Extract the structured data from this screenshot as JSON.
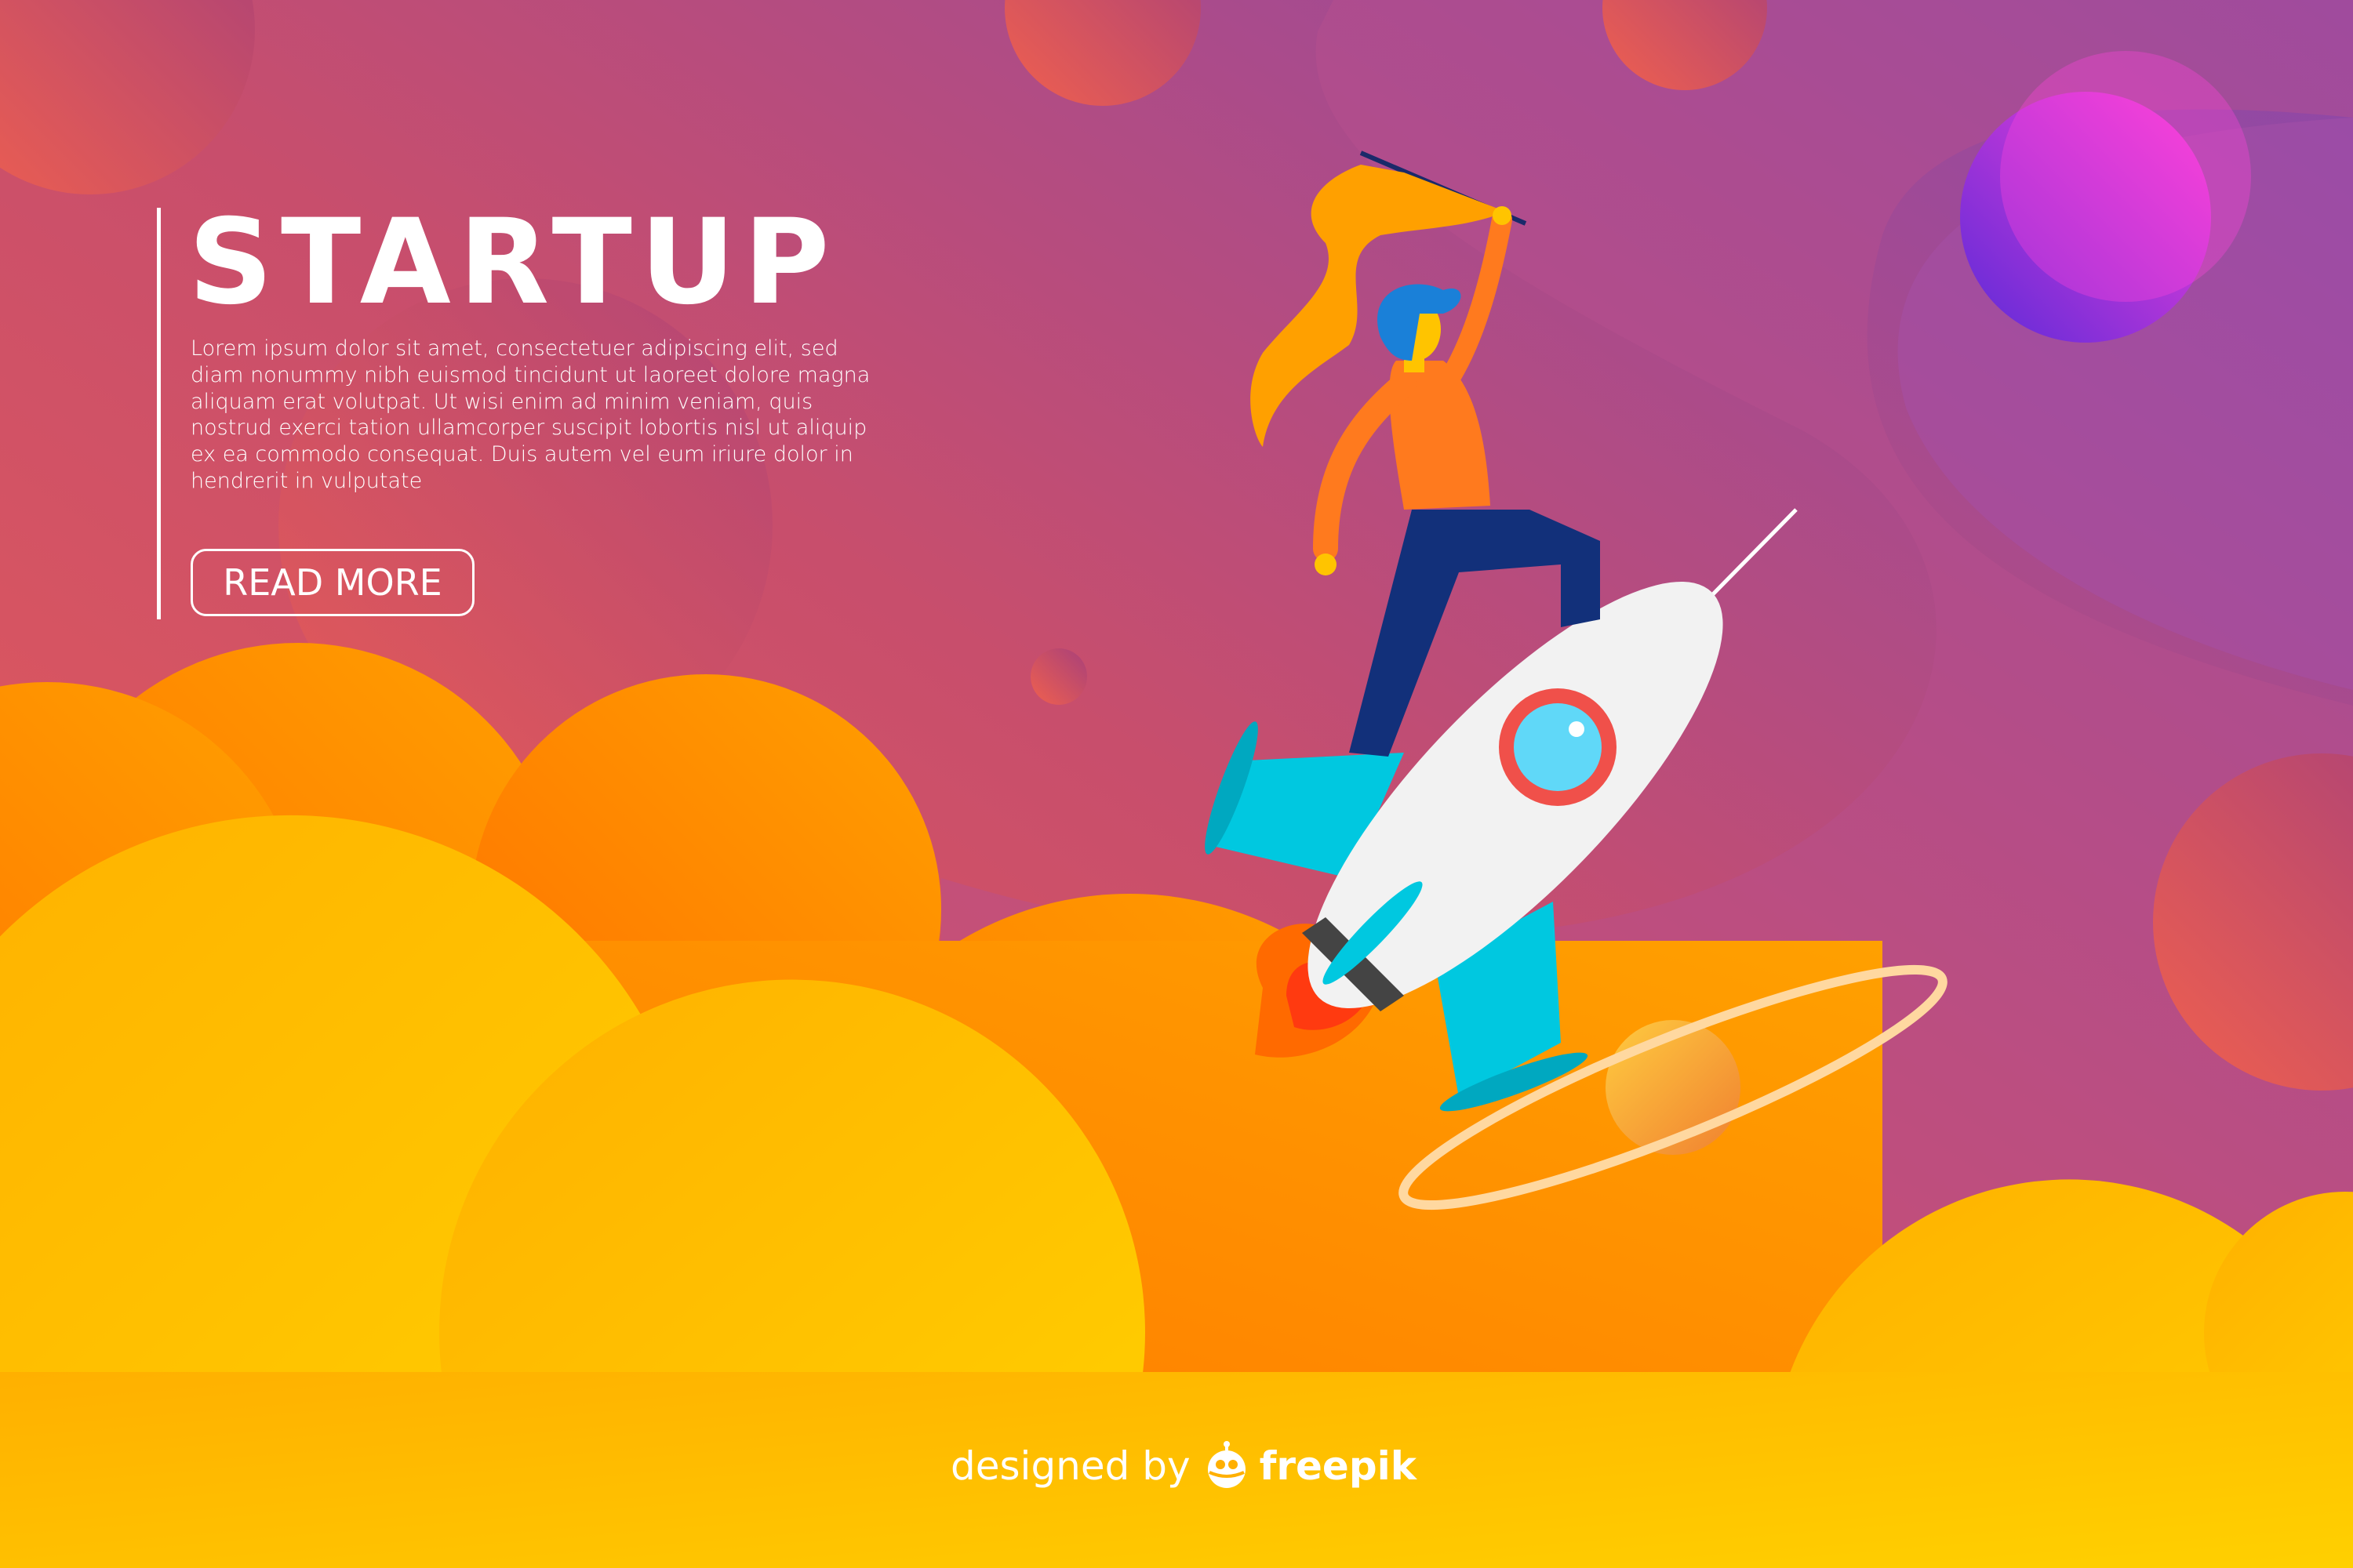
{
  "hero": {
    "title": "STARTUP",
    "body": "Lorem ipsum dolor sit amet, consectetuer adipiscing elit, sed diam nonummy nibh euismod tincidunt ut laoreet dolore magna aliquam erat volutpat. Ut wisi enim ad minim veniam, quis nostrud exerci tation ullamcorper suscipit lobortis nisl ut aliquip ex ea commodo consequat. Duis autem vel eum iriure dolor in hendrerit in vulputate",
    "button_label": "READ MORE"
  },
  "credit": {
    "prefix": "designed by",
    "brand": "freepik",
    "logo_icon": "freepik-mascot-icon"
  },
  "colors": {
    "bg_left": "#e45a5a",
    "bg_right": "#8e48a8",
    "cloud_orange": "#ff8a00",
    "cloud_yellow": "#ffc400",
    "rocket_accent": "#00c8e0"
  }
}
